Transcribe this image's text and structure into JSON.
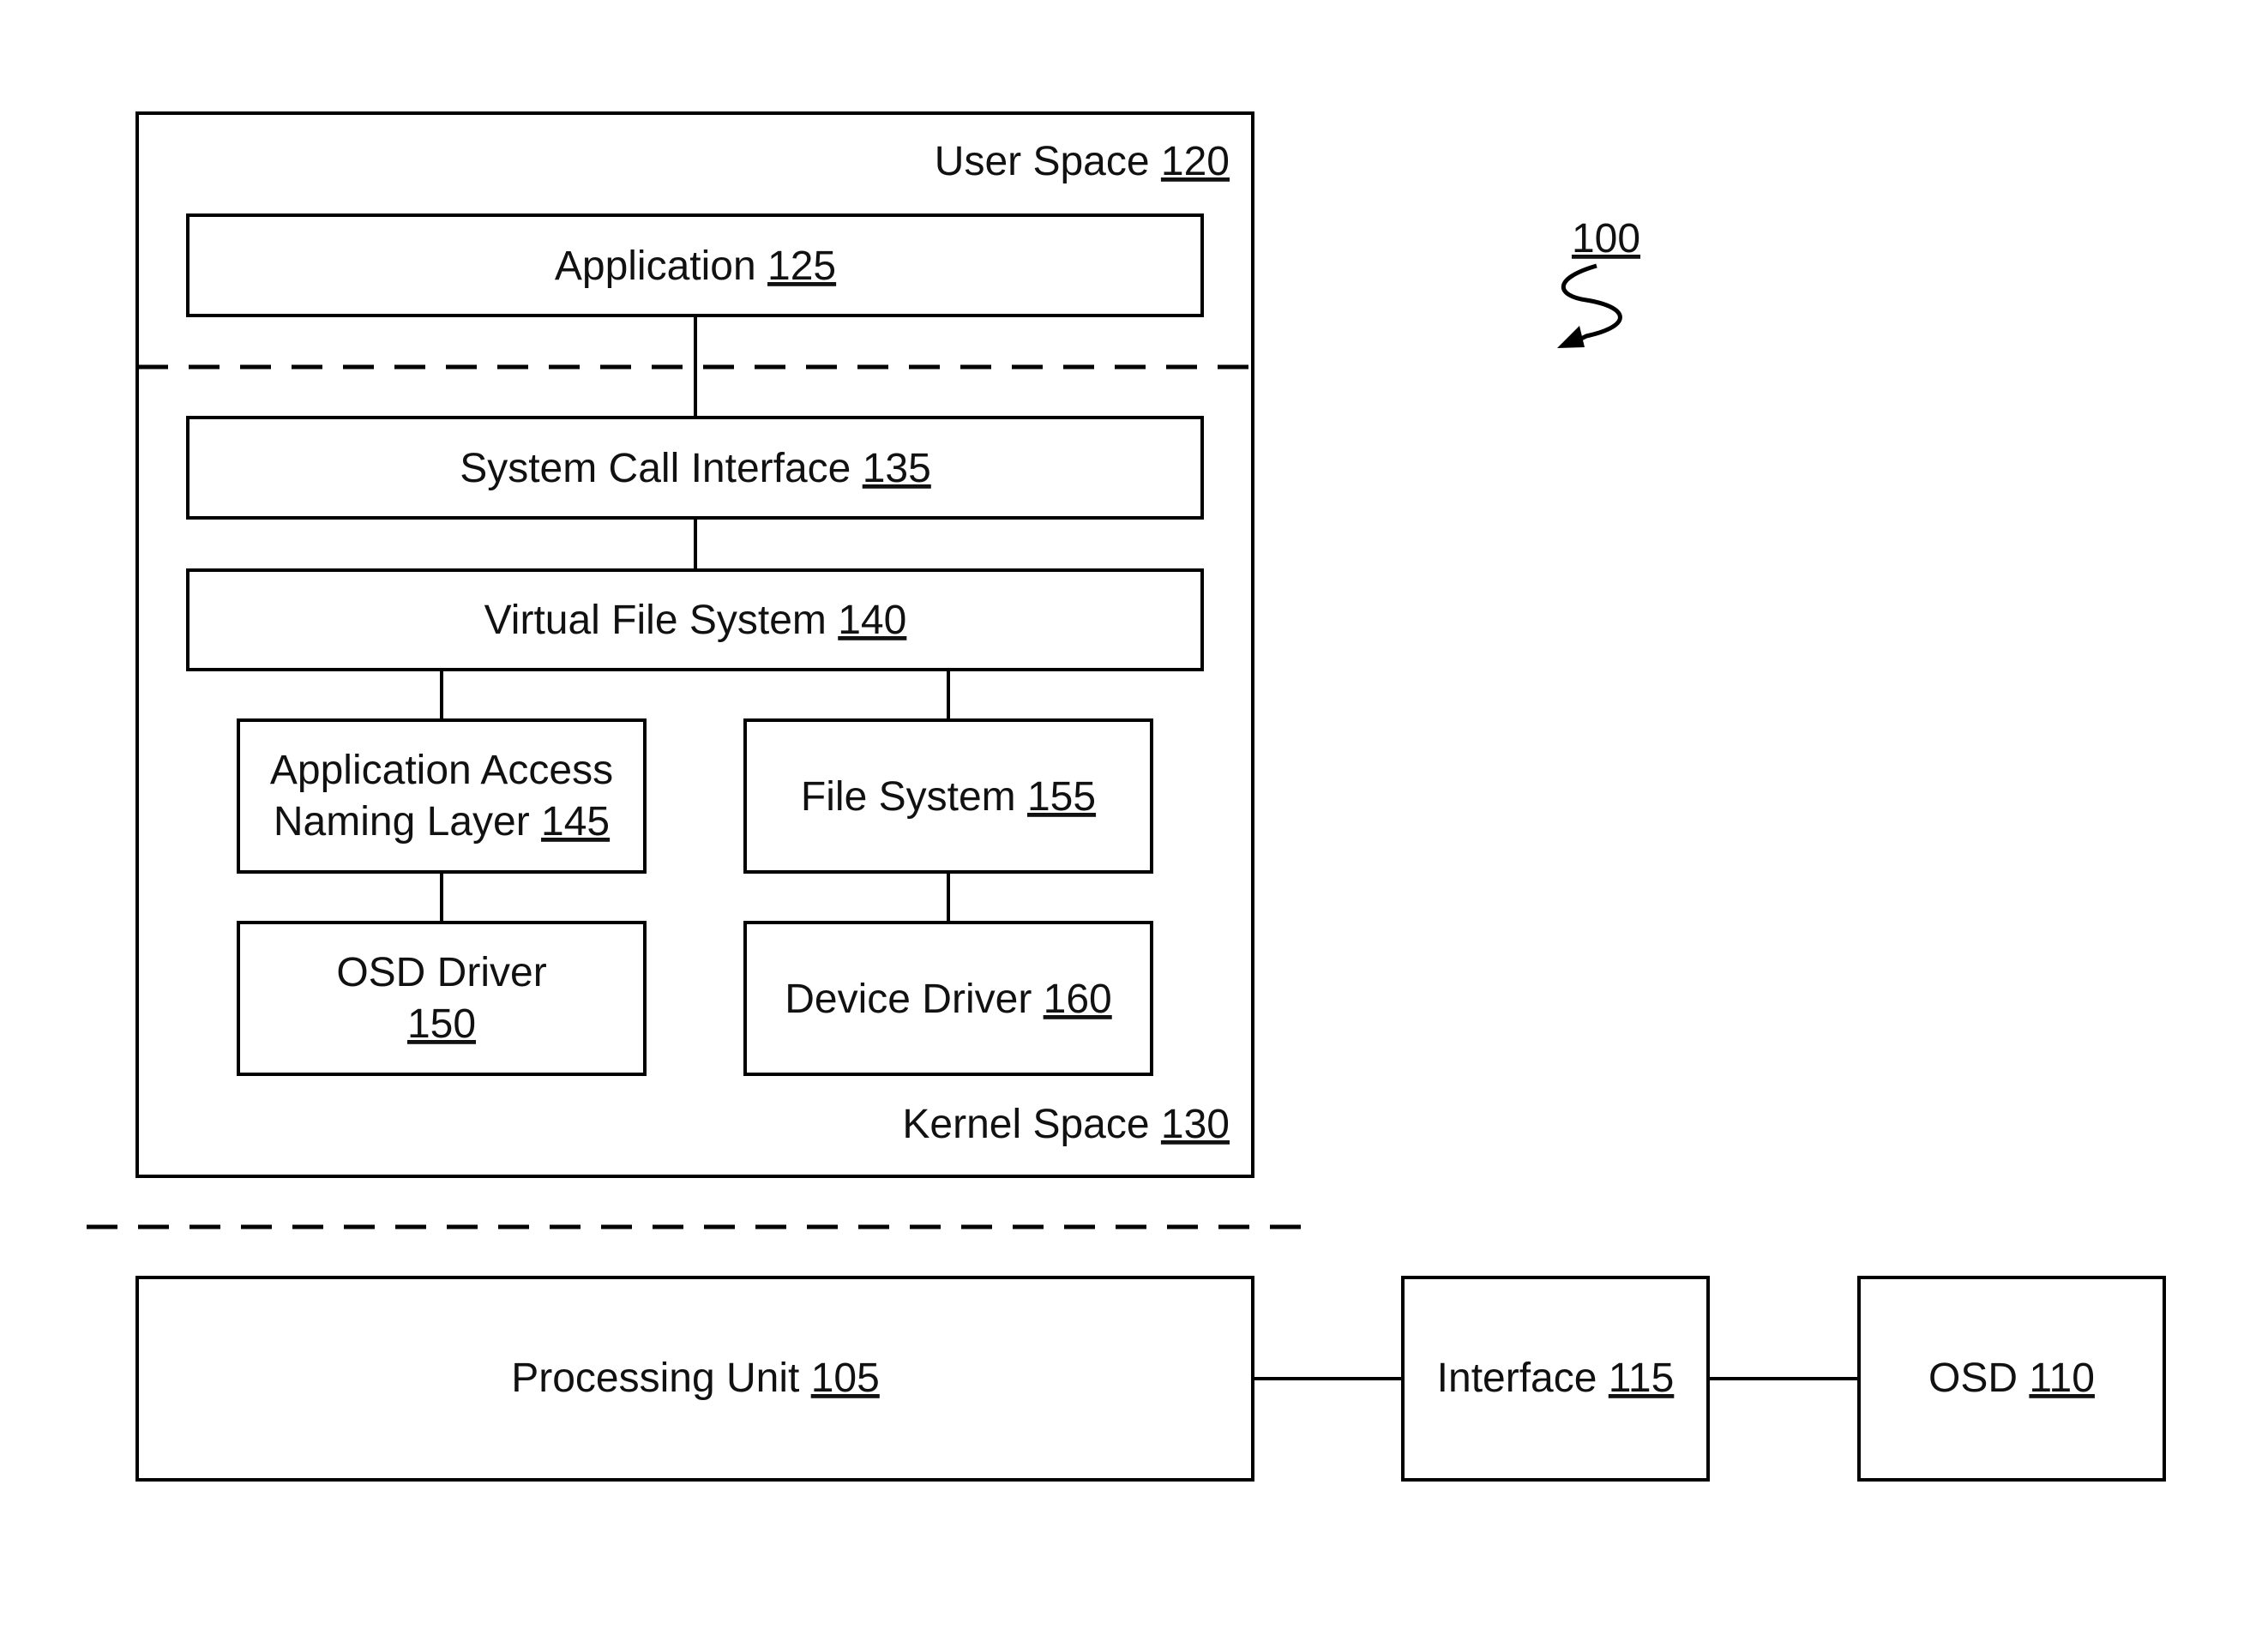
{
  "figure_ref": "100",
  "user_space": {
    "label": "User Space",
    "ref": "120"
  },
  "kernel_space": {
    "label": "Kernel Space",
    "ref": "130"
  },
  "blocks": {
    "application": {
      "label": "Application",
      "ref": "125"
    },
    "sci": {
      "label": "System Call Interface",
      "ref": "135"
    },
    "vfs": {
      "label": "Virtual File System",
      "ref": "140"
    },
    "aanl": {
      "line1": "Application Access",
      "line2": "Naming Layer",
      "ref": "145"
    },
    "fs": {
      "label": "File System",
      "ref": "155"
    },
    "osd_driver": {
      "line1": "OSD Driver",
      "ref": "150"
    },
    "device_driver": {
      "label": "Device Driver",
      "ref": "160"
    },
    "processing_unit": {
      "label": "Processing Unit",
      "ref": "105"
    },
    "interface": {
      "label": "Interface",
      "ref": "115"
    },
    "osd": {
      "label": "OSD",
      "ref": "110"
    }
  }
}
